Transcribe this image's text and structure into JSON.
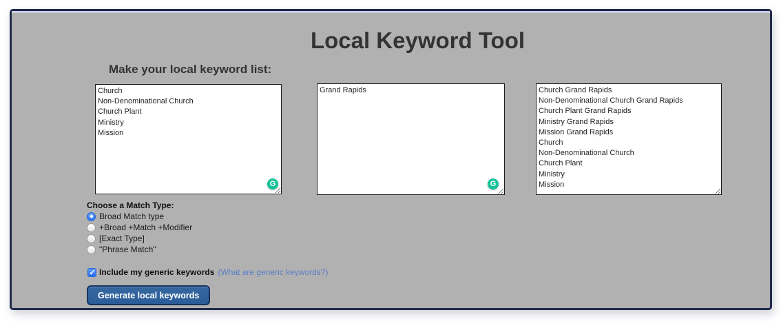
{
  "page": {
    "title": "Local Keyword Tool",
    "section_heading": "Make your local keyword list:"
  },
  "keyword_lists": {
    "generic_keywords": "Church\nNon-Denominational Church\nChurch Plant\nMinistry\nMission",
    "location": "Grand Rapids",
    "generated": "Church Grand Rapids\nNon-Denominational Church Grand Rapids\nChurch Plant Grand Rapids\nMinistry Grand Rapids\nMission Grand Rapids\nChurch\nNon-Denominational Church\nChurch Plant\nMinistry\nMission"
  },
  "match_type": {
    "heading": "Choose a Match Type:",
    "options": [
      {
        "label": "Broad Match type",
        "selected": true
      },
      {
        "label": "+Broad +Match +Modifier",
        "selected": false
      },
      {
        "label": "[Exact Type]",
        "selected": false
      },
      {
        "label": "\"Phrase Match\"",
        "selected": false
      }
    ]
  },
  "generic_toggle": {
    "label": "Include my generic keywords",
    "checked": true,
    "help_link": "(What are generic keywords?)"
  },
  "actions": {
    "generate_label": "Generate local keywords"
  },
  "icons": {
    "grammarly_glyph": "G"
  },
  "colors": {
    "frame_border": "#1f2a4a",
    "page_background": "#b1b1b1",
    "accent_blue": "#2f7bf0",
    "button_background": "#2e5f9c",
    "link_blue": "#5b7fc7",
    "grammarly_green": "#15c39a"
  }
}
